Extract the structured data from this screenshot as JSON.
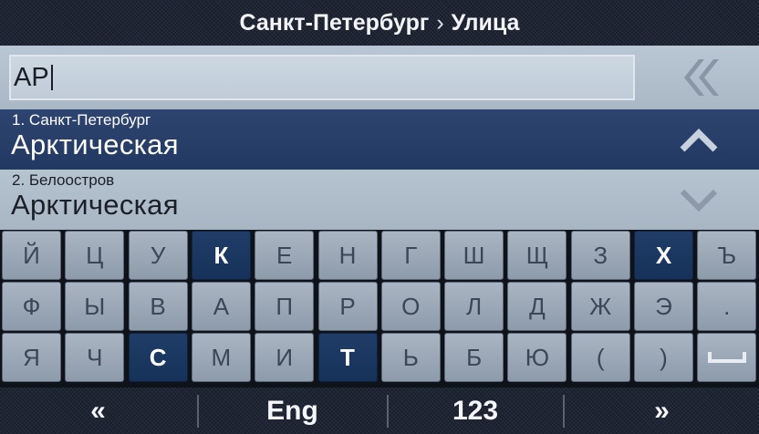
{
  "header": {
    "location": "Санкт-Петербург",
    "separator": "›",
    "page": "Улица"
  },
  "search": {
    "value": "АР"
  },
  "results": [
    {
      "index_city": "1. Санкт-Петербург",
      "street": "Арктическая"
    },
    {
      "index_city": "2. Белоостров",
      "street": "Арктическая"
    }
  ],
  "keyboard": {
    "rows": [
      [
        "Й",
        "Ц",
        "У",
        "К",
        "Е",
        "Н",
        "Г",
        "Ш",
        "Щ",
        "З",
        "Х",
        "Ъ"
      ],
      [
        "Ф",
        "Ы",
        "В",
        "А",
        "П",
        "Р",
        "О",
        "Л",
        "Д",
        "Ж",
        "Э",
        "."
      ],
      [
        "Я",
        "Ч",
        "С",
        "М",
        "И",
        "Т",
        "Ь",
        "Б",
        "Ю",
        "(",
        ")"
      ]
    ],
    "highlighted": [
      "К",
      "Х",
      "С",
      "Т"
    ],
    "space_icon": "space-icon"
  },
  "bottom_bar": {
    "back": "«",
    "language": "Eng",
    "numbers": "123",
    "forward": "»"
  },
  "icons": {
    "backspace": "double-chevron-left-icon",
    "up": "chevron-up-icon",
    "down": "chevron-down-icon"
  },
  "colors": {
    "selected_row": "#2d4470",
    "highlight_key": "#1f3d68",
    "key": "#a9b5c2",
    "text_light": "#ffffff"
  }
}
